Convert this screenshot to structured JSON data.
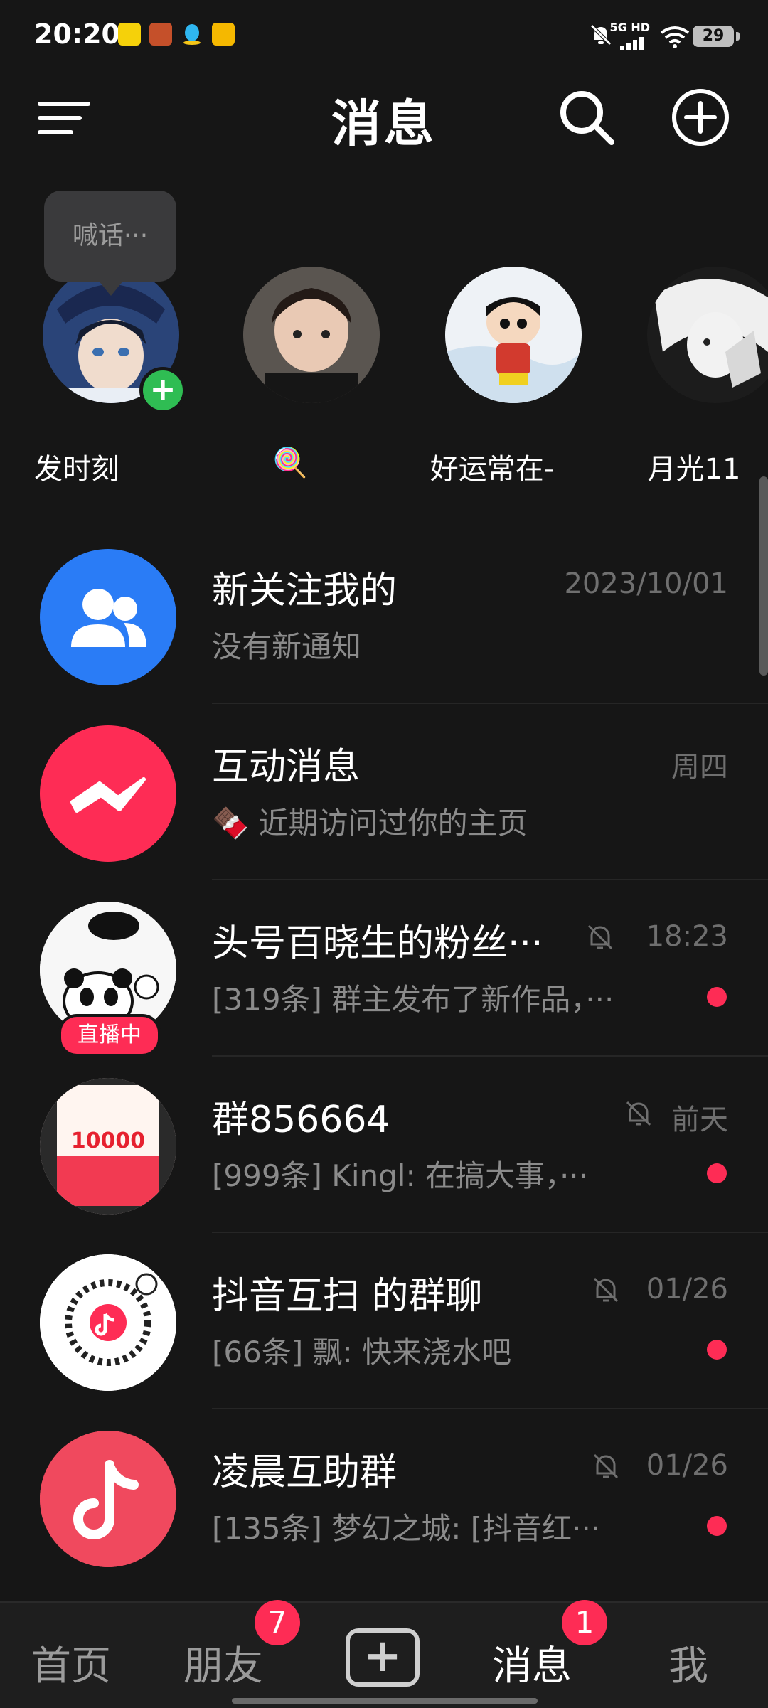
{
  "status_bar": {
    "time": "20:20",
    "network_label": "5G HD",
    "battery": "29",
    "icons": [
      "app-yellow-icon",
      "game-avatar-icon",
      "qq-icon",
      "app-badge-icon",
      "bell-off-icon",
      "signal-icon",
      "wifi-icon",
      "battery-icon"
    ]
  },
  "header": {
    "title": "消息",
    "menu_icon": "menu-icon",
    "search_icon": "search-icon",
    "add_icon": "add-circle-icon"
  },
  "stories": {
    "bubble": "喊话···",
    "items": [
      {
        "name": "发时刻"
      },
      {
        "name": "🍭"
      },
      {
        "name": "好运常在-"
      },
      {
        "name": "月光11"
      }
    ]
  },
  "chats": [
    {
      "title": "新关注我的",
      "subtitle": "没有新通知",
      "time": "2023/10/01",
      "muted": false,
      "unread": false
    },
    {
      "title": "互动消息",
      "subtitle_emoji": "🍫",
      "subtitle": "近期访问过你的主页",
      "time": "周四",
      "muted": false,
      "unread": false
    },
    {
      "title": "头号百晓生的粉丝···",
      "subtitle": "[319条] 群主发布了新作品，···",
      "time": "18:23",
      "muted": true,
      "unread": true,
      "tag": "直播中"
    },
    {
      "title": "群856664",
      "subtitle": "[999条] Kingl: 在搞大事，···",
      "time": "前天",
      "muted": true,
      "unread": true,
      "avatar_text": "10000"
    },
    {
      "title": "抖音互扫 的群聊",
      "subtitle": "[66条] 飘: 快来浇水吧",
      "time": "01/26",
      "muted": true,
      "unread": true
    },
    {
      "title": "凌晨互助群",
      "subtitle": "[135条] 梦幻之城: [抖音红···",
      "time": "01/26",
      "muted": true,
      "unread": true
    }
  ],
  "bottom_nav": {
    "home": "首页",
    "friends": "朋友",
    "friends_badge": "7",
    "messages": "消息",
    "messages_badge": "1",
    "me": "我",
    "create_symbol": "+"
  },
  "colors": {
    "accent": "#fe2c55",
    "background": "#161616",
    "green": "#2fbd53",
    "blue": "#2a7cf6"
  }
}
